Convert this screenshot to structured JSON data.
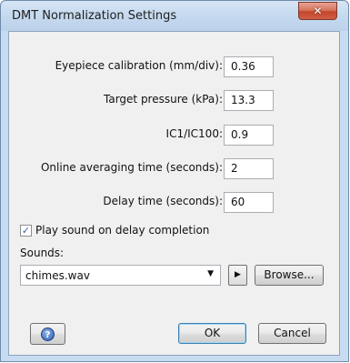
{
  "window": {
    "title": "DMT Normalization Settings",
    "close_glyph": "✕"
  },
  "fields": [
    {
      "label": "Eyepiece calibration (mm/div):",
      "value": "0.36"
    },
    {
      "label": "Target pressure (kPa):",
      "value": "13.3"
    },
    {
      "label": "IC1/IC100:",
      "value": "0.9"
    },
    {
      "label": "Online averaging time (seconds):",
      "value": "2"
    },
    {
      "label": "Delay time (seconds):",
      "value": "60"
    }
  ],
  "checkbox": {
    "label": "Play sound on delay completion",
    "checked": true,
    "glyph": "✓"
  },
  "sounds": {
    "label": "Sounds:",
    "selected": "chimes.wav",
    "arrow": "▼",
    "play_glyph": "▶"
  },
  "buttons": {
    "browse": "Browse...",
    "ok": "OK",
    "cancel": "Cancel",
    "help_glyph": "?"
  }
}
